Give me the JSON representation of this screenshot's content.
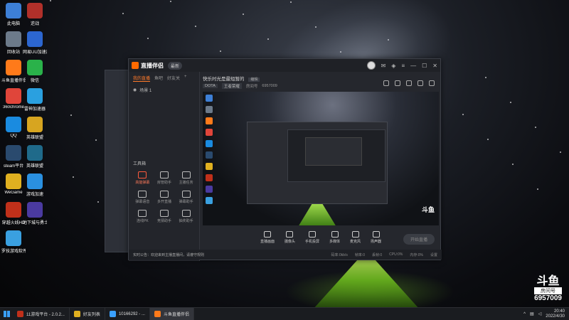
{
  "desktop": {
    "icons": [
      {
        "label": "此电脑",
        "color": "#3d7fd6"
      },
      {
        "label": "逆战",
        "color": "#b0302a"
      },
      {
        "label": "回收站",
        "color": "#6c7a8a"
      },
      {
        "label": "网易UU加速器",
        "color": "#2c66d0"
      },
      {
        "label": "斗鱼直播伴侣",
        "color": "#ff7a1a"
      },
      {
        "label": "微信",
        "color": "#2ab24a"
      },
      {
        "label": "360chrome",
        "color": "#e0453a"
      },
      {
        "label": "雷神加速器",
        "color": "#2aa0e0"
      },
      {
        "label": "QQ",
        "color": "#1a8be0"
      },
      {
        "label": "英雄联盟",
        "color": "#d7a520"
      },
      {
        "label": "steam平台",
        "color": "#2a4a6e"
      },
      {
        "label": "英雄联盟",
        "color": "#1f6a8a"
      },
      {
        "label": "WeGame",
        "color": "#e0b020"
      },
      {
        "label": "游戏加速",
        "color": "#2a90e0"
      },
      {
        "label": "穿越火线HD",
        "color": "#c0301a"
      },
      {
        "label": "地下城与勇士",
        "color": "#4a3aa0"
      },
      {
        "label": "罗技游戏软件",
        "color": "#3aa0e0"
      }
    ]
  },
  "app": {
    "title": "直播伴侣",
    "version": "最新",
    "tabs": [
      "我的直播",
      "鱼吧",
      "好友关"
    ],
    "scene": "场景 1",
    "tools_title": "工具箱",
    "tools": [
      {
        "label": "高能弹幕",
        "hot": true
      },
      {
        "label": "房管助手",
        "hot": false
      },
      {
        "label": "主播任务",
        "hot": false
      },
      {
        "label": "弹幕语音",
        "hot": false
      },
      {
        "label": "多开直播",
        "hot": false
      },
      {
        "label": "弹幕助手",
        "hot": false
      },
      {
        "label": "连线PK",
        "hot": false
      },
      {
        "label": "竞猜助手",
        "hot": false
      },
      {
        "label": "抽奖助手",
        "hot": false
      }
    ],
    "stream_title": "快乐时光是最短暂的",
    "edit_label": "编辑",
    "category": "DOTA",
    "subcategory": "王者荣耀",
    "room_label": "房间号",
    "room_id": "6957009",
    "controls": [
      "直播画面",
      "摄像头",
      "手机投屏",
      "多媒体",
      "麦克风",
      "扬声器"
    ],
    "start_button": "开始直播",
    "status_left": "实时公告：欢迎来到主播直播间，请遵守规则",
    "status_right": [
      "码率:0kb/s",
      "帧率:0",
      "丢帧:0",
      "CPU:0%",
      "内存:0%",
      "设置"
    ]
  },
  "taskbar": {
    "tasks": [
      {
        "label": "11游戏平台 - 2.0.2...",
        "color": "#c0301a",
        "active": false
      },
      {
        "label": "好友列表",
        "color": "#e0b020",
        "active": false
      },
      {
        "label": "10166292 - ...",
        "color": "#3aa0ff",
        "active": false
      },
      {
        "label": "斗鱼直播伴侣",
        "color": "#ff7a1a",
        "active": true
      }
    ],
    "time": "20:40",
    "date": "2022/4/30"
  },
  "overlay": {
    "brand": "斗鱼",
    "room_label": "房间号",
    "room_number": "6957009"
  }
}
